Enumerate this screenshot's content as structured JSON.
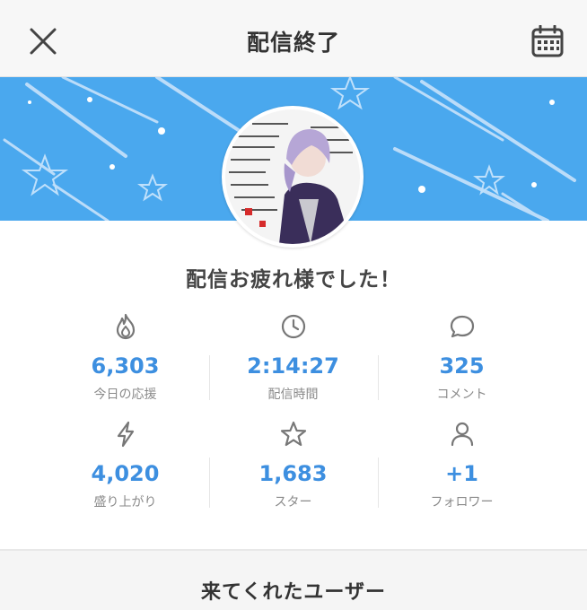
{
  "header": {
    "title": "配信終了",
    "close_icon": "close-icon",
    "calendar_icon": "calendar-icon"
  },
  "banner": {
    "background_color": "#4aa8ee"
  },
  "message": "配信お疲れ様でした！",
  "stats": [
    {
      "icon": "flame-icon",
      "value": "6,303",
      "label": "今日の応援"
    },
    {
      "icon": "clock-icon",
      "value": "2:14:27",
      "label": "配信時間"
    },
    {
      "icon": "speech-bubble-icon",
      "value": "325",
      "label": "コメント"
    },
    {
      "icon": "lightning-icon",
      "value": "4,020",
      "label": "盛り上がり"
    },
    {
      "icon": "star-icon",
      "value": "1,683",
      "label": "スター"
    },
    {
      "icon": "person-icon",
      "value": "+1",
      "label": "フォロワー"
    }
  ],
  "colors": {
    "accent": "#3d8fe0",
    "label": "#8a8a8a"
  },
  "section": {
    "title": "来てくれたユーザー"
  }
}
